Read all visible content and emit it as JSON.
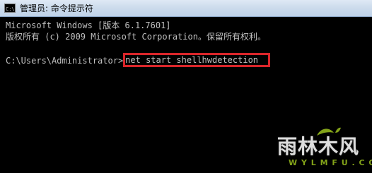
{
  "window": {
    "title": "管理员: 命令提示符",
    "icon": "cmd-icon"
  },
  "console": {
    "line1": "Microsoft Windows [版本 6.1.7601]",
    "line2": "版权所有 (c) 2009 Microsoft Corporation。保留所有权利。",
    "prompt": "C:\\Users\\Administrator>",
    "command": "net start shellhwdetection",
    "highlight_color": "#d9252a",
    "text_color": "#c0c0c0",
    "background": "#000000"
  },
  "watermark": {
    "logo": "雨林木风",
    "url": "W Y L M F U . C O M"
  }
}
